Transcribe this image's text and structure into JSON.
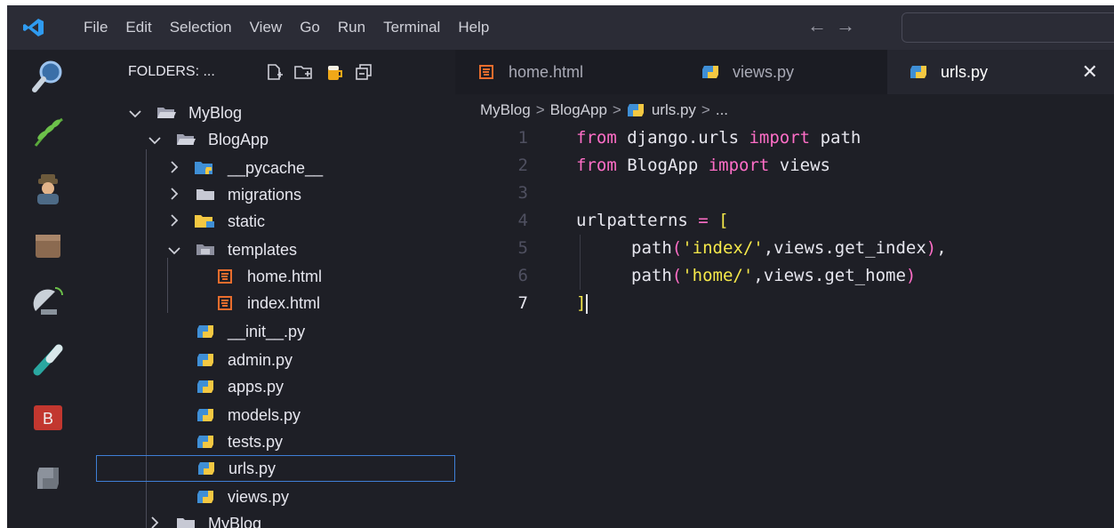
{
  "menu": [
    "File",
    "Edit",
    "Selection",
    "View",
    "Go",
    "Run",
    "Terminal",
    "Help"
  ],
  "nav": {
    "back": "←",
    "forward": "→"
  },
  "sidebar": {
    "header": "FOLDERS: ...",
    "tree": [
      {
        "label": "MyBlog",
        "chev": "v",
        "icon": "folder-open-icon"
      },
      {
        "label": "BlogApp",
        "chev": "v",
        "icon": "folder-open-icon"
      },
      {
        "label": "__pycache__",
        "chev": ">",
        "icon": "python-folder-icon"
      },
      {
        "label": "migrations",
        "chev": ">",
        "icon": "folder-icon"
      },
      {
        "label": "static",
        "chev": ">",
        "icon": "static-folder-icon"
      },
      {
        "label": "templates",
        "chev": "v",
        "icon": "templates-folder-icon"
      },
      {
        "label": "home.html",
        "chev": "",
        "icon": "html-file-icon"
      },
      {
        "label": "index.html",
        "chev": "",
        "icon": "html-file-icon"
      },
      {
        "label": "__init__.py",
        "chev": "",
        "icon": "python-file-icon"
      },
      {
        "label": "admin.py",
        "chev": "",
        "icon": "python-file-icon"
      },
      {
        "label": "apps.py",
        "chev": "",
        "icon": "python-file-icon"
      },
      {
        "label": "models.py",
        "chev": "",
        "icon": "python-file-icon"
      },
      {
        "label": "tests.py",
        "chev": "",
        "icon": "python-file-icon"
      },
      {
        "label": "urls.py",
        "chev": "",
        "icon": "python-file-icon",
        "selected": true
      },
      {
        "label": "views.py",
        "chev": "",
        "icon": "python-file-icon"
      },
      {
        "label": "MyBlog",
        "chev": ">",
        "icon": "folder-icon"
      }
    ]
  },
  "tabs": [
    {
      "label": "home.html",
      "icon": "html-file-icon",
      "active": false
    },
    {
      "label": "views.py",
      "icon": "python-file-icon",
      "active": false
    },
    {
      "label": "urls.py",
      "icon": "python-file-icon",
      "active": true,
      "close": "✕"
    }
  ],
  "breadcrumbs": {
    "items": [
      "MyBlog",
      "BlogApp",
      "urls.py",
      "..."
    ],
    "sep": ">"
  },
  "code": {
    "line_numbers": [
      "1",
      "2",
      "3",
      "4",
      "5",
      "6",
      "7"
    ],
    "current_line": "7",
    "l1_from": "from",
    "l1_mod": " django.urls ",
    "l1_import": "import",
    "l1_name": " path",
    "l2_from": "from",
    "l2_mod": " BlogApp ",
    "l2_import": "import",
    "l2_name": " views",
    "l4_name": "urlpatterns ",
    "l4_eq": "=",
    "l4_br": " [",
    "l5_fn": "path",
    "l5_po": "(",
    "l5_str": "'index/'",
    "l5_rest": ",views.get_index",
    "l5_pc": ")",
    "l5_comma": ",",
    "l6_fn": "path",
    "l6_po": "(",
    "l6_str": "'home/'",
    "l6_rest": ",views.get_home",
    "l6_pc": ")",
    "l7_br": "]"
  },
  "colors": {
    "accent": "#3f7fd6",
    "keyword": "#ff6ec7",
    "string": "#f6e94a",
    "background": "#1e1f26"
  }
}
